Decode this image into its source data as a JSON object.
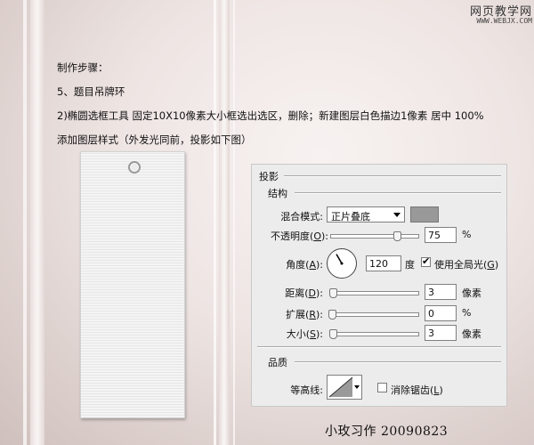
{
  "watermark": {
    "site_cn": "网页教学网",
    "site_url": "WWW.WEBJX.COM"
  },
  "instructions": {
    "heading": "制作步骤：",
    "step": "5、题目吊牌环",
    "detail": "2)椭圆选框工具 固定10X10像素大小框选出选区，删除；新建图层白色描边1像素 居中 100%",
    "note": "添加图层样式（外发光同前，投影如下图）"
  },
  "panel": {
    "title": "投影",
    "structure_title": "结构",
    "blend_mode": {
      "label": "混合模式:",
      "value": "正片叠底",
      "color": "#999999"
    },
    "opacity": {
      "label": "不透明度",
      "key": "O",
      "value": "75",
      "unit": "%",
      "level_percent": 75
    },
    "angle": {
      "label": "角度",
      "key": "A",
      "value": "120",
      "unit": "度",
      "degrees": 120
    },
    "global_light": {
      "label": "使用全局光",
      "key": "G",
      "checked": true
    },
    "distance": {
      "label": "距离",
      "key": "D",
      "value": "3",
      "unit": "像素"
    },
    "spread": {
      "label": "扩展",
      "key": "R",
      "value": "0",
      "unit": "%"
    },
    "size": {
      "label": "大小",
      "key": "S",
      "value": "3",
      "unit": "像素"
    },
    "quality_title": "品质",
    "contour": {
      "label": "等高线:"
    },
    "anti_alias": {
      "label": "消除锯齿",
      "key": "L",
      "checked": false
    }
  },
  "signature": "小玫习作  20090823"
}
